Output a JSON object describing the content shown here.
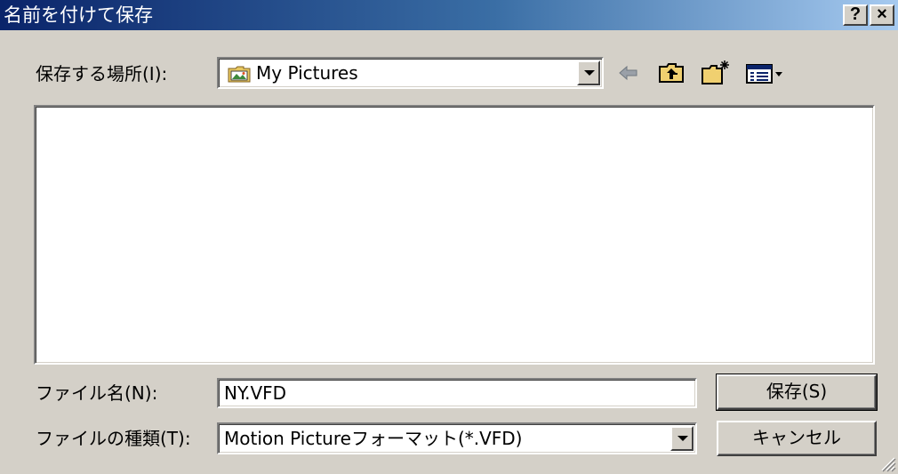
{
  "window": {
    "title": "名前を付けて保存",
    "help_glyph": "?",
    "close_glyph": "×"
  },
  "save_in": {
    "label_text": "保存する場所",
    "label_key": "(I):",
    "value": "My Pictures",
    "icon": "folder-pictures-icon"
  },
  "toolbar": {
    "icons": [
      "back-arrow-icon",
      "up-one-level-icon",
      "new-folder-icon",
      "view-menu-icon"
    ]
  },
  "file_list": {
    "items": []
  },
  "file_name": {
    "label_text": "ファイル名",
    "label_key": "(N):",
    "value": "NY.VFD"
  },
  "file_type": {
    "label_text": "ファイルの種類",
    "label_key": "(T):",
    "value": "Motion Pictureフォーマット(*.VFD)"
  },
  "buttons": {
    "save_label": "保存(S)",
    "cancel_label": "キャンセル"
  },
  "colors": {
    "title_bar_start": "#0a246a",
    "title_bar_end": "#a6caf0",
    "dialog_bg": "#d4d0c8"
  }
}
